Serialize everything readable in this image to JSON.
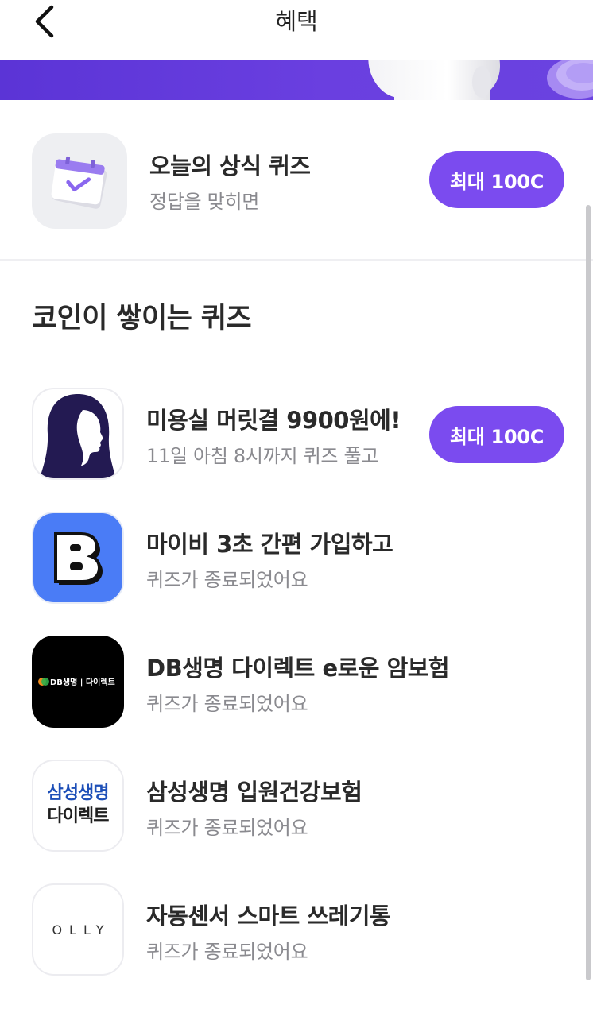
{
  "header": {
    "title": "혜택",
    "back_icon": "chevron-left-icon"
  },
  "daily_quiz": {
    "icon": "calendar-check-icon",
    "title": "오늘의 상식 퀴즈",
    "subtitle": "정답을 맞히면",
    "reward_button": "최대 100C"
  },
  "section": {
    "title": "코인이 쌓이는 퀴즈"
  },
  "quizzes": [
    {
      "icon": "hair-salon-silhouette-icon",
      "title": "미용실 머릿결 9900원에!",
      "subtitle": "11일 아침 8시까지 퀴즈 풀고",
      "reward_button": "최대 100C"
    },
    {
      "icon": "mybee-b-logo-icon",
      "title": "마이비 3초 간편 가입하고",
      "subtitle": "퀴즈가 종료되었어요"
    },
    {
      "icon": "db-life-direct-logo-icon",
      "title": "DB생명 다이렉트 e로운 암보험",
      "subtitle": "퀴즈가 종료되었어요",
      "logo_text": "DB생명 | 다이렉트"
    },
    {
      "icon": "samsung-life-direct-logo-icon",
      "title": "삼성생명 입원건강보험",
      "subtitle": "퀴즈가 종료되었어요",
      "logo_line1": "삼성생명",
      "logo_line2": "다이렉트"
    },
    {
      "icon": "olly-logo-icon",
      "title": "자동센서 스마트 쓰레기통",
      "subtitle": "퀴즈가 종료되었어요",
      "logo_text": "OLLY"
    }
  ],
  "colors": {
    "accent": "#7b4bef",
    "banner": "#6a3fe0",
    "subtext": "#8a8a8f",
    "mybee_blue": "#4a7cf6"
  }
}
